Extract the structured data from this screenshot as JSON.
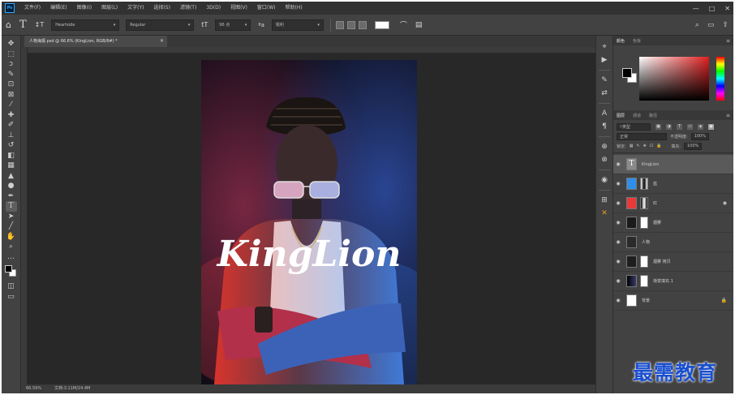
{
  "app": {
    "logo": "Ps",
    "menu": [
      "文件(F)",
      "编辑(E)",
      "图像(I)",
      "图层(L)",
      "文字(Y)",
      "选择(S)",
      "滤镜(T)",
      "3D(D)",
      "视图(V)",
      "窗口(W)",
      "帮助(H)"
    ],
    "window_controls": {
      "minimize": "—",
      "maximize": "□",
      "close": "✕"
    }
  },
  "options_bar": {
    "font_family": "Heartside",
    "font_style": "Regular",
    "font_size": "96 点",
    "anti_alias": "锐利",
    "text_color": "#ffffff"
  },
  "document": {
    "tab_title": "人物海报.psd @ 66.6% (KingLion, RGB/8#) *",
    "artwork_text": "KingLion",
    "status_zoom": "66.59%",
    "status_info": "文档:3.11M/24.4M"
  },
  "color_panel": {
    "tabs": [
      "颜色",
      "色板"
    ],
    "active_tab": 0
  },
  "layers_panel": {
    "tabs": [
      "图层",
      "通道",
      "路径"
    ],
    "active_tab": 0,
    "filter_label": "类型",
    "blend_mode": "正常",
    "opacity_label": "不透明度:",
    "opacity_value": "100%",
    "lock_label": "锁定:",
    "fill_label": "填充:",
    "fill_value": "100%",
    "layers": [
      {
        "name": "KingLion",
        "type": "text",
        "selected": true,
        "thumb": "#8a8a8a",
        "has_mask": false
      },
      {
        "name": "蓝",
        "type": "fill",
        "selected": false,
        "thumb": "#2f8fe8",
        "has_mask": true
      },
      {
        "name": "红",
        "type": "fill",
        "selected": false,
        "thumb": "#e83a3a",
        "has_mask": true,
        "extra_icon": "◉"
      },
      {
        "name": "烟雾",
        "type": "pixel",
        "selected": false,
        "thumb": "#1a1a1a",
        "has_mask": true
      },
      {
        "name": "人物",
        "type": "pixel",
        "selected": false,
        "thumb": "#2a2a2a",
        "has_mask": false
      },
      {
        "name": "烟雾 拷贝",
        "type": "pixel",
        "selected": false,
        "thumb": "#1e1e1e",
        "has_mask": true
      },
      {
        "name": "渐变填充 1",
        "type": "gradient",
        "selected": false,
        "thumb": "#10101a",
        "has_mask": true
      },
      {
        "name": "背景",
        "type": "background",
        "selected": false,
        "thumb": "#ffffff",
        "has_mask": false,
        "extra_icon": "🔒"
      }
    ]
  },
  "watermark": "最需教育"
}
